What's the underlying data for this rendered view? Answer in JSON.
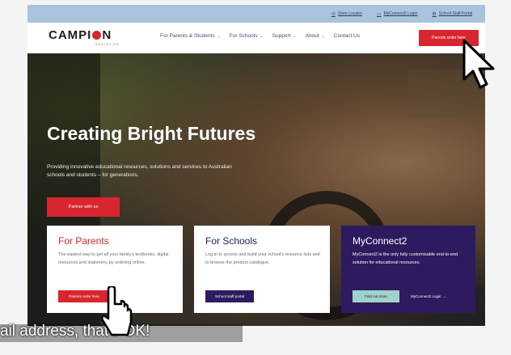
{
  "utility": {
    "links": [
      {
        "icon": "pin-icon",
        "glyph": "⊙",
        "label": "Store Locator"
      },
      {
        "icon": "screen-icon",
        "glyph": "▭",
        "label": "MyConnect2 Login"
      },
      {
        "icon": "gear-icon",
        "glyph": "⚙",
        "label": "School Staff Portal"
      }
    ]
  },
  "header": {
    "logo_pre": "CAMPI",
    "logo_post": "N",
    "logo_sub": "EDUCATION",
    "nav": [
      {
        "label": "For Parents & Students",
        "chevron": "⌄"
      },
      {
        "label": "For Schools",
        "chevron": "⌄"
      },
      {
        "label": "Support",
        "chevron": "⌄"
      },
      {
        "label": "About",
        "chevron": "⌄"
      },
      {
        "label": "Contact Us",
        "chevron": ""
      }
    ],
    "cta": "Parents order here"
  },
  "hero": {
    "title": "Creating Bright Futures",
    "description": "Providing innovative educational resources, solutions and services to Australian schools and students – for generations.",
    "partner_button": "Partner with us"
  },
  "cards": {
    "parents": {
      "title": "For Parents",
      "text": "The easiest way to get all your family's textbooks, digital resources and stationery, by ordering online.",
      "button": "Parents order here"
    },
    "schools": {
      "title": "For Schools",
      "text": "Log in to access and build your school's resource lists and to browse the product catalogue.",
      "button": "School staff portal"
    },
    "myconnect": {
      "title": "MyConnect2",
      "text": "MyConnect2 is the only fully customisable end-to-end solution for educational resources.",
      "button": "Find out more",
      "login": "MyConnect2 Login",
      "login_arrow": "→"
    }
  },
  "caption": "ail address, that's OK!",
  "colors": {
    "brand_red": "#d8262f",
    "brand_purple": "#2e1a5e",
    "utility_bar": "#aac3dd",
    "mint": "#9fd3c9"
  }
}
